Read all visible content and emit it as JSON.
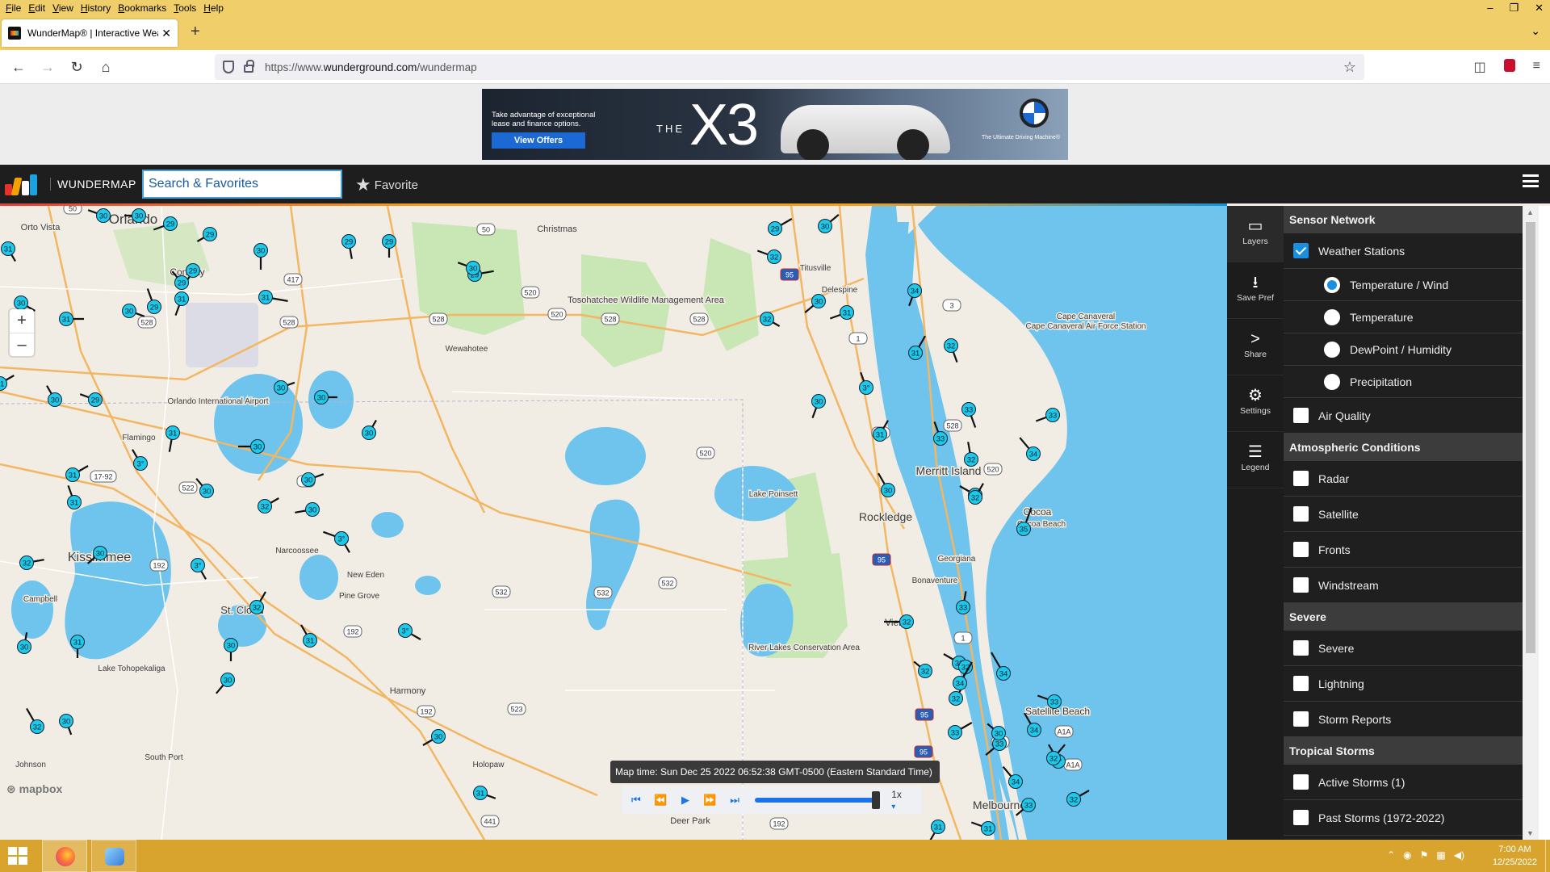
{
  "browser": {
    "menu": [
      "File",
      "Edit",
      "View",
      "History",
      "Bookmarks",
      "Tools",
      "Help"
    ],
    "tab_title": "WunderMap® | Interactive Wea",
    "url_prefix": "https://www.",
    "url_domain": "wunderground.com",
    "url_path": "/wundermap"
  },
  "ad": {
    "copy": "Take advantage of exceptional lease and finance options.",
    "cta": "View Offers",
    "model_prefix": "THE",
    "model": "X3",
    "slogan": "The Ultimate Driving Machine®"
  },
  "header": {
    "brand": "WUNDERMAP",
    "search_placeholder": "Search & Favorites",
    "favorite_label": "Favorite"
  },
  "map": {
    "time_label": "Map time: Sun Dec 25 2022 06:52:38 GMT-0500 (Eastern Standard Time)",
    "speed": "1x",
    "attribution": "mapbox",
    "places": [
      {
        "name": "Orlando",
        "size": 17
      },
      {
        "name": "Orto Vista",
        "size": 11
      },
      {
        "name": "Conway",
        "size": 12
      },
      {
        "name": "Orlando International Airport",
        "size": 10
      },
      {
        "name": "Flamingo",
        "size": 10
      },
      {
        "name": "Kissimmee",
        "size": 16
      },
      {
        "name": "Campbell",
        "size": 10
      },
      {
        "name": "St. Cloud",
        "size": 13
      },
      {
        "name": "Narcoossee",
        "size": 10
      },
      {
        "name": "New Eden",
        "size": 10
      },
      {
        "name": "Pine Grove",
        "size": 10
      },
      {
        "name": "Lake Tohopekaliga",
        "size": 10
      },
      {
        "name": "Harmony",
        "size": 11
      },
      {
        "name": "South Port",
        "size": 10
      },
      {
        "name": "Johnson",
        "size": 10
      },
      {
        "name": "Holopaw",
        "size": 10
      },
      {
        "name": "Deer Park",
        "size": 11
      },
      {
        "name": "Christmas",
        "size": 11
      },
      {
        "name": "Wewahotee",
        "size": 10
      },
      {
        "name": "Tosohatchee Wildlife Management Area",
        "size": 11
      },
      {
        "name": "Lake Poinsett",
        "size": 10
      },
      {
        "name": "River Lakes Conservation Area",
        "size": 10
      },
      {
        "name": "Merritt Island",
        "size": 14
      },
      {
        "name": "Rockledge",
        "size": 14
      },
      {
        "name": "Cocoa",
        "size": 12
      },
      {
        "name": "Cocoa Beach",
        "size": 10
      },
      {
        "name": "Cape Canaveral",
        "size": 10
      },
      {
        "name": "Cape Canaveral Air Force Station",
        "size": 10
      },
      {
        "name": "Delespine",
        "size": 10
      },
      {
        "name": "Georgiana",
        "size": 10
      },
      {
        "name": "Bonaventure",
        "size": 10
      },
      {
        "name": "Viera",
        "size": 12
      },
      {
        "name": "Satellite Beach",
        "size": 12
      },
      {
        "name": "Melbourne",
        "size": 14
      },
      {
        "name": "Titusville",
        "size": 10
      }
    ],
    "stations": [
      {
        "v": "30"
      },
      {
        "v": "30"
      },
      {
        "v": "29"
      },
      {
        "v": "29"
      },
      {
        "v": "29"
      },
      {
        "v": "31"
      },
      {
        "v": "29"
      },
      {
        "v": "30"
      },
      {
        "v": "29"
      },
      {
        "v": "31"
      },
      {
        "v": "30"
      },
      {
        "v": "31"
      },
      {
        "v": "29"
      },
      {
        "v": "29"
      },
      {
        "v": "31"
      },
      {
        "v": "30"
      },
      {
        "v": "29"
      },
      {
        "v": "31"
      },
      {
        "v": "30"
      },
      {
        "v": "29"
      },
      {
        "v": "30"
      },
      {
        "v": "30"
      },
      {
        "v": "30"
      },
      {
        "v": "31"
      },
      {
        "v": "30"
      },
      {
        "v": "30"
      },
      {
        "v": "30"
      },
      {
        "v": "31"
      },
      {
        "v": "31"
      },
      {
        "v": "3°"
      },
      {
        "v": "30"
      },
      {
        "v": "32"
      },
      {
        "v": "30"
      },
      {
        "v": "3°"
      },
      {
        "v": "30"
      },
      {
        "v": "32"
      },
      {
        "v": "3°"
      },
      {
        "v": "32"
      },
      {
        "v": "31"
      },
      {
        "v": "3°"
      },
      {
        "v": "30"
      },
      {
        "v": "31"
      },
      {
        "v": "30"
      },
      {
        "v": "32"
      },
      {
        "v": "30"
      },
      {
        "v": "30"
      },
      {
        "v": "31"
      },
      {
        "v": "30"
      },
      {
        "v": "30"
      },
      {
        "v": "29"
      },
      {
        "v": "30"
      },
      {
        "v": "32"
      },
      {
        "v": "30"
      },
      {
        "v": "31"
      },
      {
        "v": "32"
      },
      {
        "v": "34"
      },
      {
        "v": "31"
      },
      {
        "v": "3°"
      },
      {
        "v": "32"
      },
      {
        "v": "33"
      },
      {
        "v": "33"
      },
      {
        "v": "32"
      },
      {
        "v": "34"
      },
      {
        "v": "30"
      },
      {
        "v": "33"
      },
      {
        "v": "31"
      },
      {
        "v": "30"
      },
      {
        "v": "30"
      },
      {
        "v": "35"
      },
      {
        "v": "32"
      },
      {
        "v": "33"
      },
      {
        "v": "32"
      },
      {
        "v": "32"
      },
      {
        "v": "32"
      },
      {
        "v": "32"
      },
      {
        "v": "32"
      },
      {
        "v": "34"
      },
      {
        "v": "34"
      },
      {
        "v": "34"
      },
      {
        "v": "33"
      },
      {
        "v": "33"
      },
      {
        "v": "3°"
      },
      {
        "v": "33"
      },
      {
        "v": "33"
      },
      {
        "v": "34"
      },
      {
        "v": "32"
      },
      {
        "v": "31"
      },
      {
        "v": "31"
      },
      {
        "v": "32"
      },
      {
        "v": "30"
      }
    ],
    "shields": [
      "50",
      "50",
      "417",
      "528",
      "528",
      "528",
      "528",
      "520",
      "520",
      "520",
      "528",
      "17-92",
      "522",
      "15",
      "192",
      "192",
      "532",
      "532",
      "532",
      "192",
      "523",
      "192",
      "441",
      "3",
      "1",
      "1",
      "520",
      "528",
      "1",
      "A1A",
      "A1A",
      "1",
      "95",
      "95",
      "95",
      "95"
    ]
  },
  "tools": [
    {
      "label": "Layers",
      "icon": "layers-icon",
      "glyph": "▭"
    },
    {
      "label": "Save Pref",
      "icon": "save-icon",
      "glyph": "⭳"
    },
    {
      "label": "Share",
      "icon": "share-icon",
      "glyph": ">"
    },
    {
      "label": "Settings",
      "icon": "gear-icon",
      "glyph": "⚙"
    },
    {
      "label": "Legend",
      "icon": "legend-icon",
      "glyph": "☰"
    }
  ],
  "panel": {
    "sensor_title": "Sensor Network",
    "weather_stations": "Weather Stations",
    "temp_wind": "Temperature / Wind",
    "temperature": "Temperature",
    "dewpoint": "DewPoint / Humidity",
    "precipitation": "Precipitation",
    "air_quality": "Air Quality",
    "atmo_title": "Atmospheric Conditions",
    "radar": "Radar",
    "satellite": "Satellite",
    "fronts": "Fronts",
    "windstream": "Windstream",
    "severe_title": "Severe",
    "severe": "Severe",
    "lightning": "Lightning",
    "storm_reports": "Storm Reports",
    "tropical_title": "Tropical Storms",
    "active_storms": "Active Storms (1)",
    "past_storms": "Past Storms (1972-2022)"
  },
  "taskbar": {
    "time": "7:00 AM",
    "date": "12/25/2022"
  },
  "colors": {
    "station_fill": "#1ec8e8",
    "water": "#6fc4ee",
    "green_area": "#c9e6b5",
    "wu_dark": "#1e1e1e",
    "checkbox_on": "#1a8fe0"
  }
}
